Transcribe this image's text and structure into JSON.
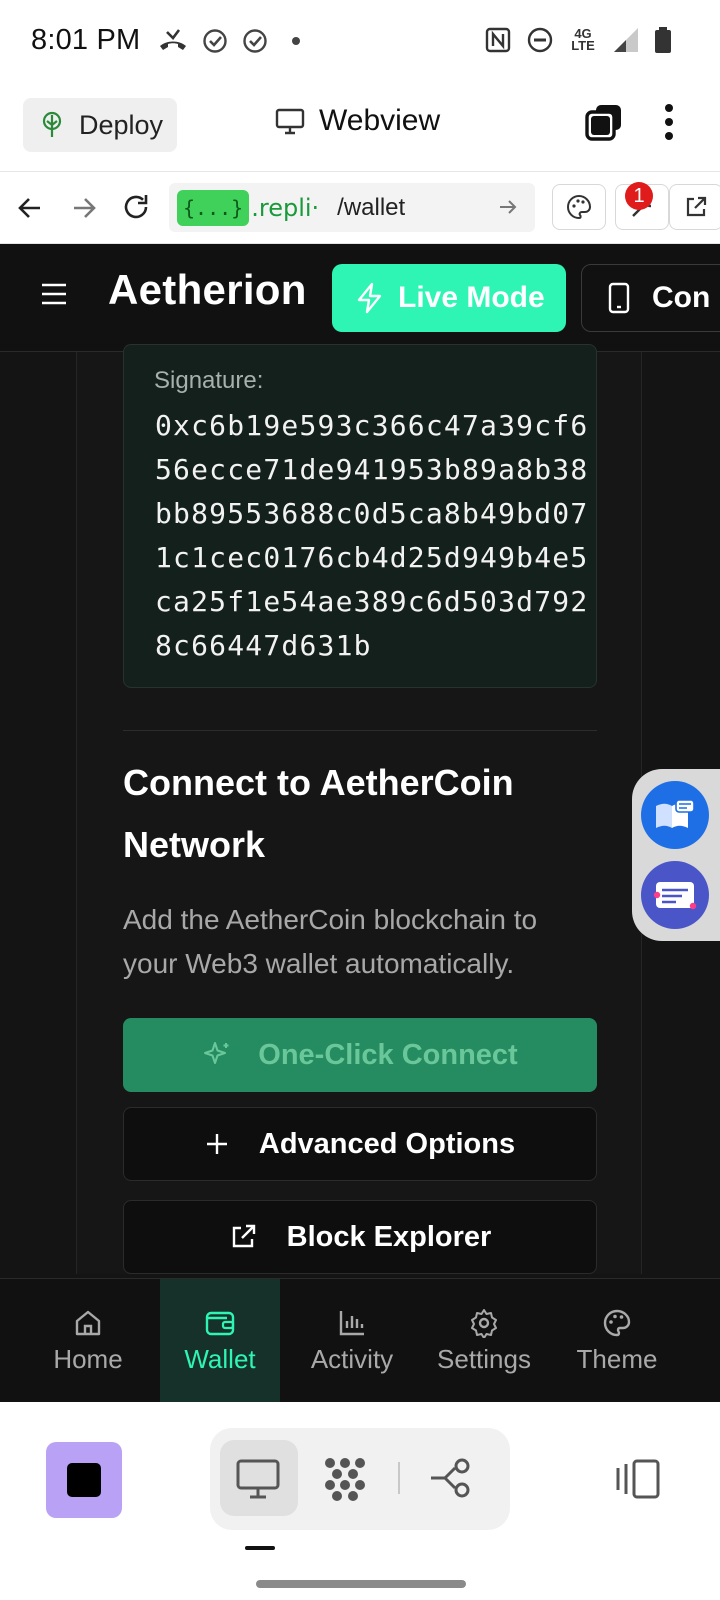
{
  "status_bar": {
    "time": "8:01 PM",
    "network": "4G LTE"
  },
  "replit_header": {
    "deploy_label": "Deploy",
    "webview_label": "Webview"
  },
  "browser": {
    "url_badge": "{...}",
    "url_host": ".repli·",
    "url_path": "/wallet",
    "notification_count": "1"
  },
  "app": {
    "brand": "Aetherion",
    "live_mode_label": "Live Mode",
    "connect_label": "Con",
    "signature": {
      "label": "Signature:",
      "value": "0xc6b19e593c366c47a39cf656ecce71de941953b89a8b38bb89553688c0d5ca8b49bd071c1cec0176cb4d25d949b4e5ca25f1e54ae389c6d503d7928c66447d631b"
    },
    "connect_section": {
      "title": "Connect to AetherCoin Network",
      "description": "Add the AetherCoin blockchain to your Web3 wallet automatically.",
      "one_click_label": "One-Click Connect",
      "advanced_label": "Advanced Options",
      "explorer_label": "Block Explorer"
    },
    "tabs": [
      {
        "label": "Home",
        "icon": "home-icon"
      },
      {
        "label": "Wallet",
        "icon": "wallet-icon",
        "active": true
      },
      {
        "label": "Activity",
        "icon": "bar-chart-icon"
      },
      {
        "label": "Settings",
        "icon": "gear-icon"
      },
      {
        "label": "Theme",
        "icon": "palette-icon"
      }
    ]
  },
  "colors": {
    "accent": "#2ef5b4",
    "app_background": "#141414",
    "one_click_button": "#258c62",
    "stop_button": "#b9a2f6"
  }
}
